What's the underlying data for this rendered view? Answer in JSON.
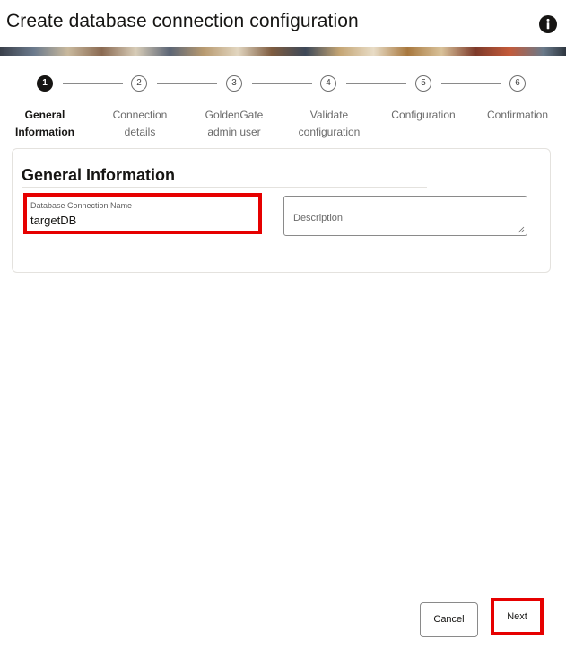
{
  "header": {
    "title": "Create database connection configuration",
    "info_icon": "info-icon"
  },
  "steps": [
    {
      "number": "1",
      "label_line1": "General",
      "label_line2": "Information",
      "active": true
    },
    {
      "number": "2",
      "label_line1": "Connection",
      "label_line2": "details",
      "active": false
    },
    {
      "number": "3",
      "label_line1": "GoldenGate",
      "label_line2": "admin user",
      "active": false
    },
    {
      "number": "4",
      "label_line1": "Validate",
      "label_line2": "configuration",
      "active": false
    },
    {
      "number": "5",
      "label_line1": "Configuration",
      "label_line2": "",
      "active": false
    },
    {
      "number": "6",
      "label_line1": "Confirmation",
      "label_line2": "",
      "active": false
    }
  ],
  "form": {
    "section_title": "General Information",
    "name_field": {
      "label": "Database Connection Name",
      "value": "targetDB"
    },
    "description_field": {
      "placeholder": "Description",
      "value": ""
    }
  },
  "footer": {
    "cancel_label": "Cancel",
    "next_label": "Next"
  },
  "colors": {
    "highlight": "#e60000",
    "text": "#161513",
    "muted": "#6a6a6a"
  }
}
